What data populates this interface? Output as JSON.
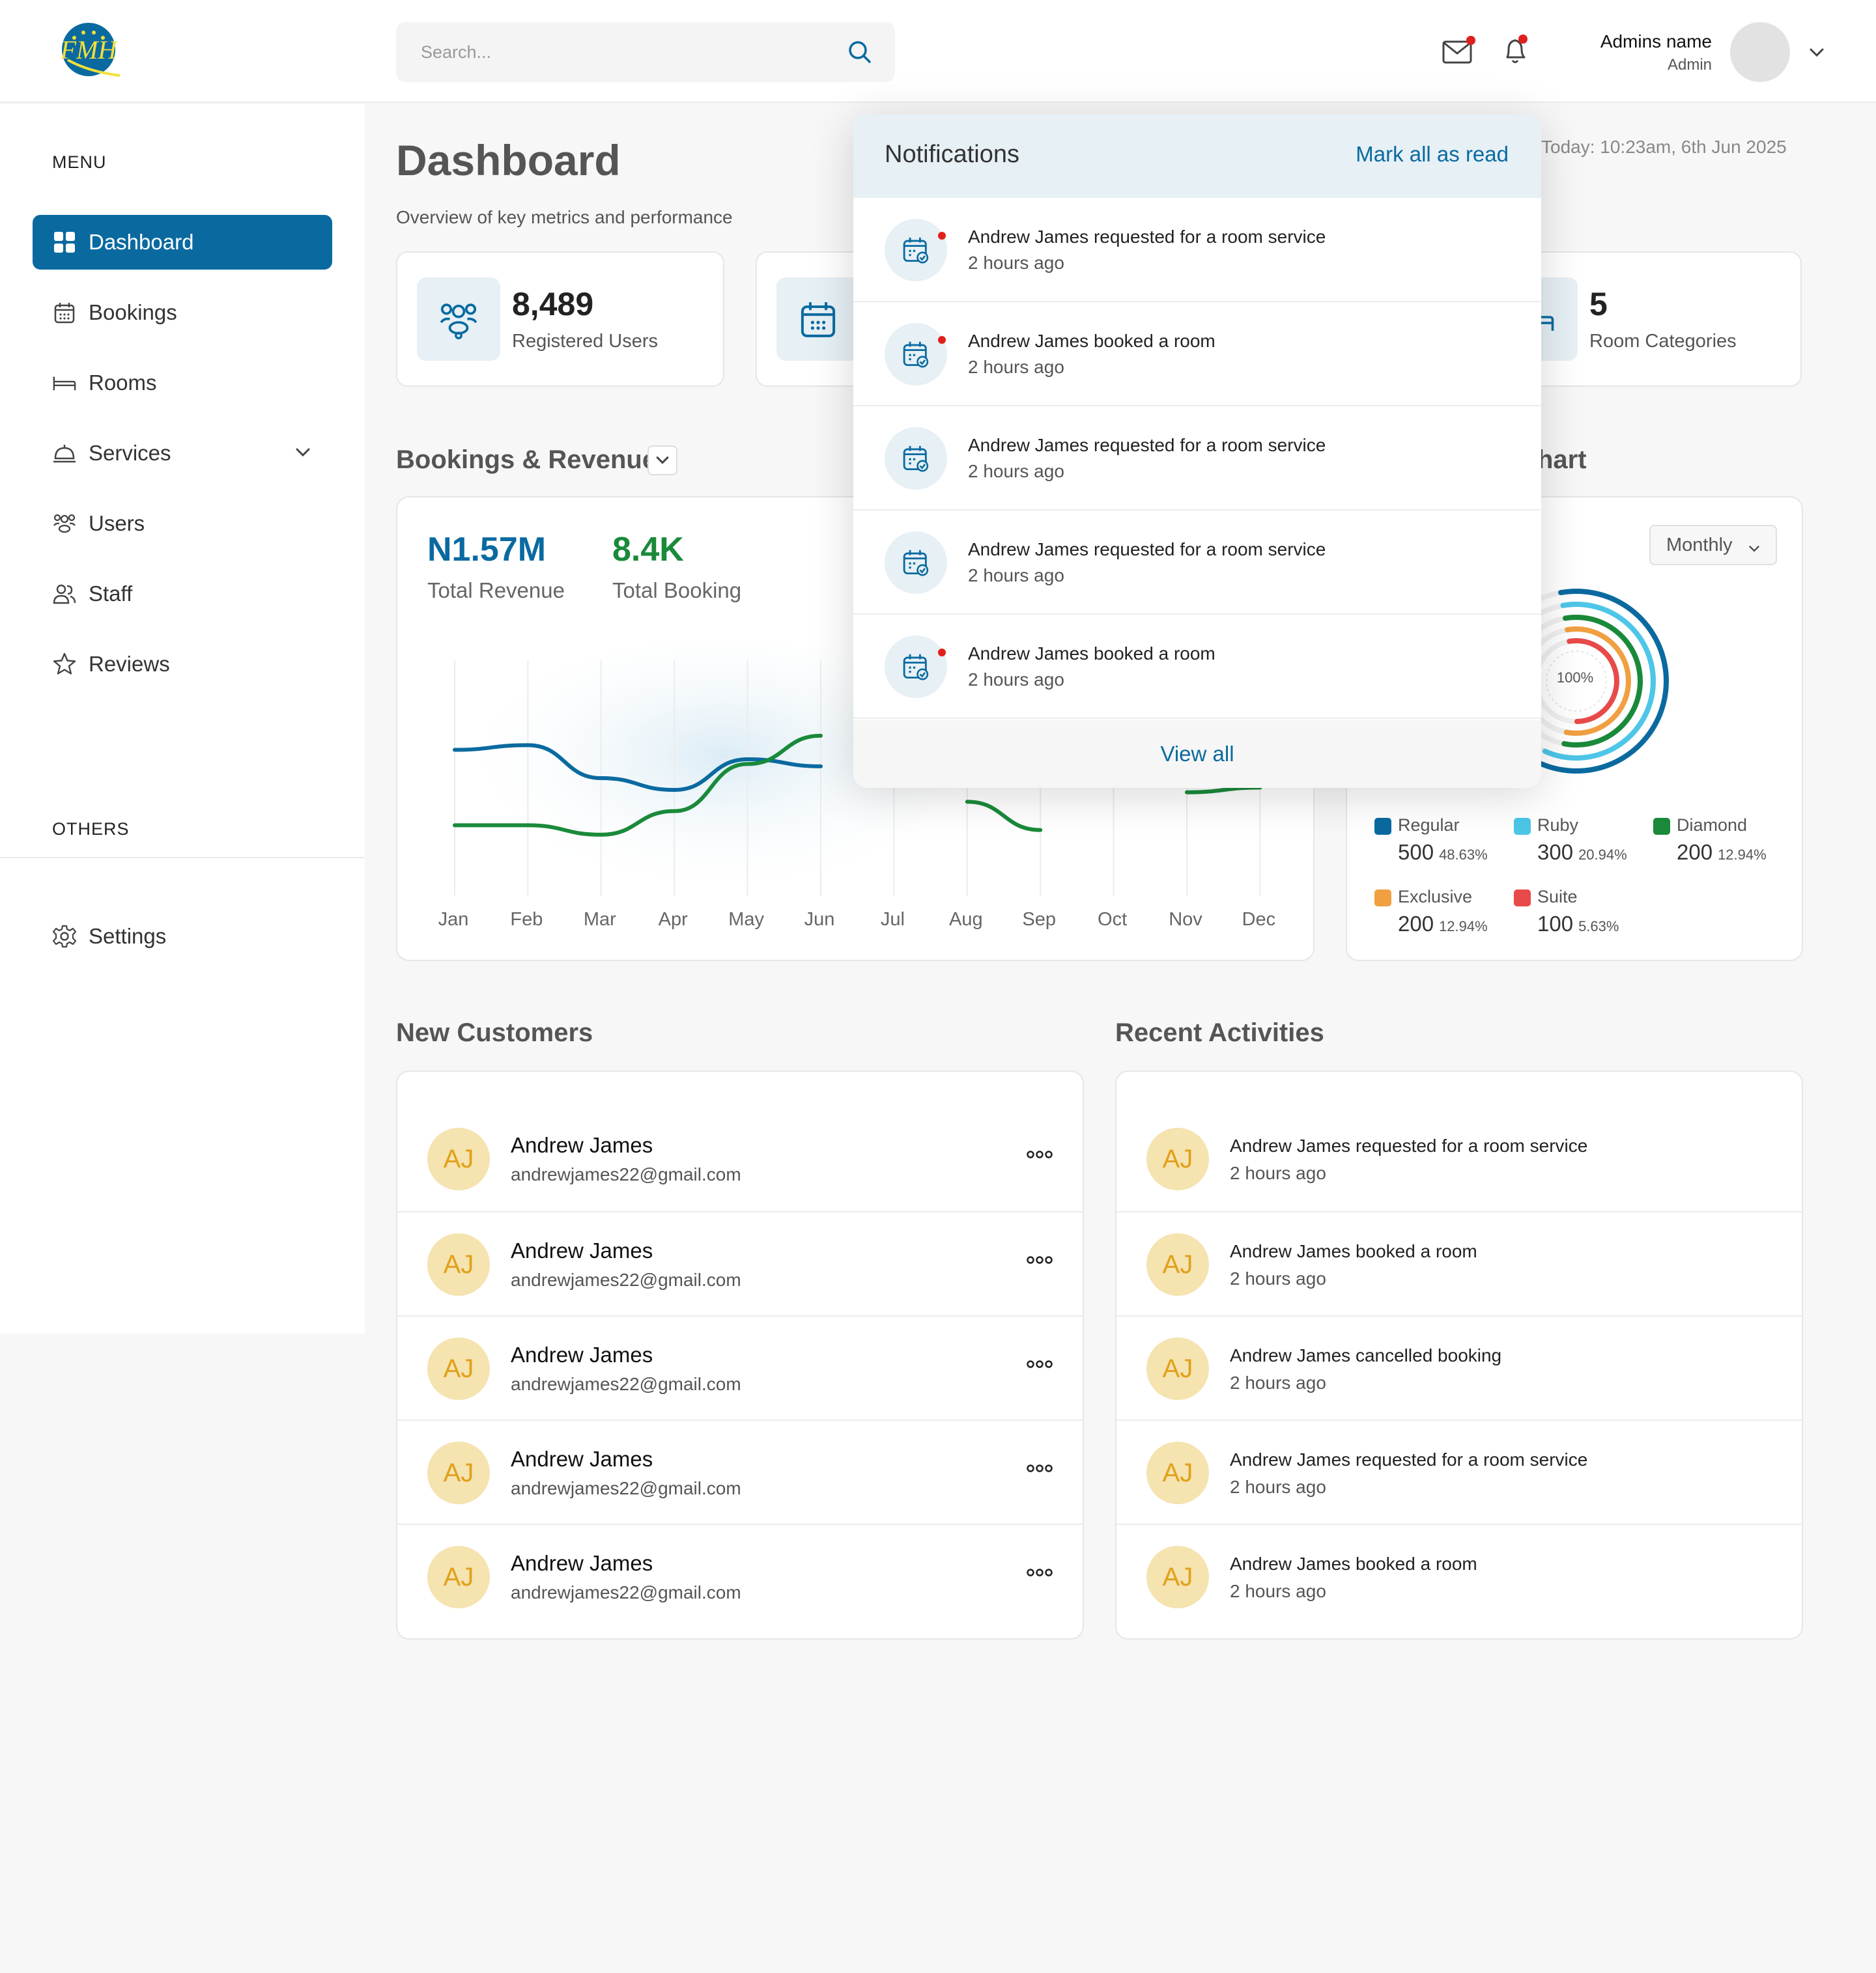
{
  "header": {
    "search_placeholder": "Search...",
    "admin_name": "Admins name",
    "admin_role": "Admin"
  },
  "sidebar": {
    "menu_heading": "MENU",
    "items": [
      {
        "label": "Dashboard",
        "icon": "grid-icon",
        "active": true
      },
      {
        "label": "Bookings",
        "icon": "calendar-icon"
      },
      {
        "label": "Rooms",
        "icon": "bed-icon"
      },
      {
        "label": "Services",
        "icon": "service-bell-icon"
      },
      {
        "label": "Users",
        "icon": "users-icon"
      },
      {
        "label": "Staff",
        "icon": "staff-icon"
      },
      {
        "label": "Reviews",
        "icon": "star-icon"
      }
    ],
    "others_heading": "OTHERS",
    "others": [
      {
        "label": "Settings",
        "icon": "gear-icon"
      }
    ]
  },
  "page": {
    "title": "Dashboard",
    "subtitle": "Overview of key metrics and performance",
    "today": "Today: 10:23am, 6th Jun 2025"
  },
  "stats": [
    {
      "value": "8,489",
      "label": "Registered Users",
      "icon": "users-icon"
    },
    {
      "value": "",
      "label": "",
      "icon": "calendar-icon"
    },
    {
      "value": "5",
      "label": "Room Categories",
      "icon": "bed-icon"
    }
  ],
  "bookings_revenue": {
    "title": "Bookings & Revenue",
    "total_revenue": "N1.57M",
    "total_revenue_label": "Total Revenue",
    "total_booking": "8.4K",
    "total_booking_label": "Total Booking"
  },
  "chart_data": {
    "type": "line",
    "categories": [
      "Jan",
      "Feb",
      "Mar",
      "Apr",
      "May",
      "Jun",
      "Jul",
      "Aug",
      "Sep",
      "Oct",
      "Nov",
      "Dec"
    ],
    "series": [
      {
        "color": "#0a6aa0",
        "values": [
          62,
          64,
          50,
          45,
          58,
          55,
          null,
          null,
          null,
          null,
          null,
          null
        ]
      },
      {
        "color": "#1a8a3a",
        "values": [
          30,
          30,
          26,
          36,
          56,
          68,
          null,
          40,
          28,
          null,
          44,
          46
        ]
      }
    ],
    "ylim": [
      0,
      100
    ]
  },
  "room_chart": {
    "title_visible": "hart",
    "period": "Monthly",
    "center_label": "100%",
    "legend": [
      {
        "name": "Regular",
        "value": "500",
        "pct": "48.63%",
        "color": "#0a6aa0",
        "fraction": 0.4863
      },
      {
        "name": "Ruby",
        "value": "300",
        "pct": "20.94%",
        "color": "#4dc6e8",
        "fraction": 0.2094
      },
      {
        "name": "Diamond",
        "value": "200",
        "pct": "12.94%",
        "color": "#1a8a3a",
        "fraction": 0.1294
      },
      {
        "name": "Exclusive",
        "value": "200",
        "pct": "12.94%",
        "color": "#f0a040",
        "fraction": 0.1294
      },
      {
        "name": "Suite",
        "value": "100",
        "pct": "5.63%",
        "color": "#e84a4a",
        "fraction": 0.0563
      }
    ]
  },
  "new_customers": {
    "title": "New Customers",
    "rows": [
      {
        "initials": "AJ",
        "name": "Andrew James",
        "email": "andrewjames22@gmail.com"
      },
      {
        "initials": "AJ",
        "name": "Andrew James",
        "email": "andrewjames22@gmail.com"
      },
      {
        "initials": "AJ",
        "name": "Andrew James",
        "email": "andrewjames22@gmail.com"
      },
      {
        "initials": "AJ",
        "name": "Andrew James",
        "email": "andrewjames22@gmail.com"
      },
      {
        "initials": "AJ",
        "name": "Andrew James",
        "email": "andrewjames22@gmail.com"
      }
    ]
  },
  "recent_activities": {
    "title": "Recent Activities",
    "rows": [
      {
        "initials": "AJ",
        "text": "Andrew James requested for a room service",
        "time": "2 hours ago"
      },
      {
        "initials": "AJ",
        "text": "Andrew James booked a room",
        "time": "2 hours ago"
      },
      {
        "initials": "AJ",
        "text": "Andrew James cancelled booking",
        "time": "2 hours ago"
      },
      {
        "initials": "AJ",
        "text": "Andrew James requested for a room service",
        "time": "2 hours ago"
      },
      {
        "initials": "AJ",
        "text": "Andrew James booked a room",
        "time": "2 hours ago"
      }
    ]
  },
  "notifications": {
    "title": "Notifications",
    "mark_all": "Mark all as read",
    "view_all": "View all",
    "items": [
      {
        "text": "Andrew James requested for a room service",
        "time": "2 hours ago",
        "unread": true
      },
      {
        "text": "Andrew James booked a room",
        "time": "2 hours ago",
        "unread": true
      },
      {
        "text": "Andrew James requested for a room service",
        "time": "2 hours ago",
        "unread": false
      },
      {
        "text": "Andrew James requested for a room service",
        "time": "2 hours ago",
        "unread": false
      },
      {
        "text": "Andrew James booked a room",
        "time": "2 hours ago",
        "unread": true
      }
    ]
  }
}
